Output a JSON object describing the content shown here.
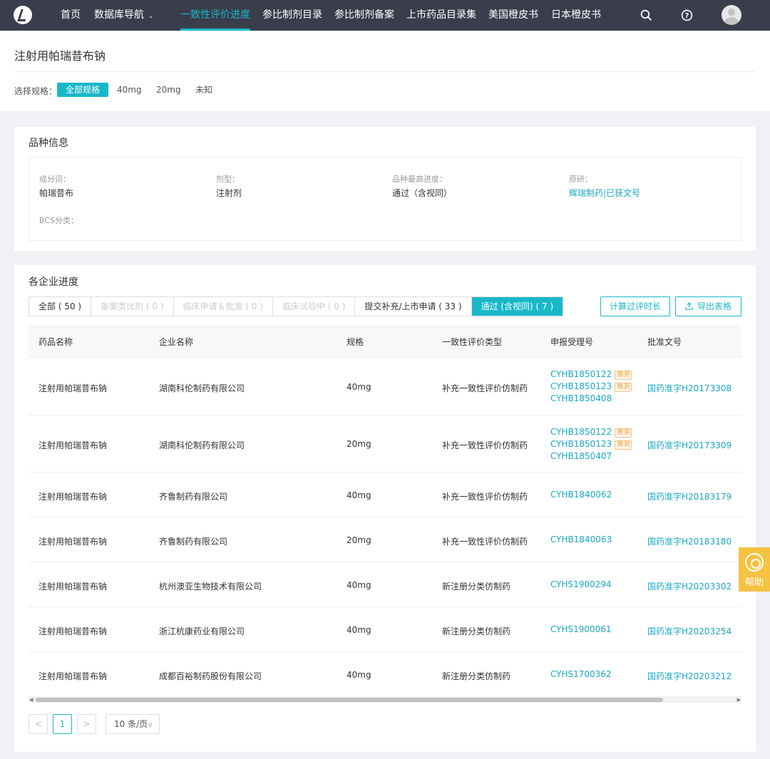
{
  "nav": {
    "items": [
      "首页",
      "数据库导航",
      "一致性评价进度",
      "参比制剂目录",
      "参比制剂备案",
      "上市药品目录集",
      "美国橙皮书",
      "日本橙皮书"
    ],
    "active_index": 2,
    "icons": [
      "search-icon",
      "help-circle-icon",
      "user-avatar"
    ]
  },
  "page": {
    "title": "注射用帕瑞昔布钠",
    "spec_label": "选择规格：",
    "spec_options": [
      "全部规格",
      "40mg",
      "20mg",
      "未知"
    ],
    "spec_selected": 0
  },
  "info": {
    "title": "品种信息",
    "fields": [
      {
        "label": "成分词：",
        "value": "帕瑞昔布"
      },
      {
        "label": "剂型：",
        "value": "注射剂"
      },
      {
        "label": "品种最高进度：",
        "value": "通过（含视同）"
      },
      {
        "label": "原研：",
        "value": "辉瑞制药|已获文号"
      },
      {
        "label": "BCS分类：",
        "value": ""
      }
    ]
  },
  "progress": {
    "title": "各企业进度",
    "tabs": [
      {
        "label": "全部 ( 50 )",
        "state": "normal"
      },
      {
        "label": "备案类比剂 ( 0 )",
        "state": "disabled"
      },
      {
        "label": "临床申请＆批准 ( 0 )",
        "state": "disabled"
      },
      {
        "label": "临床试验中 ( 0 )",
        "state": "disabled"
      },
      {
        "label": "提交补充/上市申请 ( 33 )",
        "state": "normal"
      },
      {
        "label": "通过 (含视同) ( 7 )",
        "state": "active"
      }
    ],
    "calc_button": "计算过评时长",
    "export_button": "导出表格",
    "columns": [
      "药品名称",
      "企业名称",
      "规格",
      "一致性评价类型",
      "申报受理号",
      "批准文号"
    ],
    "rows": [
      {
        "drug": "注射用帕瑞昔布钠",
        "company": "湖南科伦制药有限公司",
        "spec": "40mg",
        "type": "补充一致性评价仿制药",
        "accept": [
          {
            "no": "CYHB1850122",
            "tag": "推测"
          },
          {
            "no": "CYHB1850123",
            "tag": "推测"
          },
          {
            "no": "CYHB1850408",
            "tag": ""
          }
        ],
        "approval": "国药准字H20173308"
      },
      {
        "drug": "注射用帕瑞昔布钠",
        "company": "湖南科伦制药有限公司",
        "spec": "20mg",
        "type": "补充一致性评价仿制药",
        "accept": [
          {
            "no": "CYHB1850122",
            "tag": "推测"
          },
          {
            "no": "CYHB1850123",
            "tag": "推测"
          },
          {
            "no": "CYHB1850407",
            "tag": ""
          }
        ],
        "approval": "国药准字H20173309"
      },
      {
        "drug": "注射用帕瑞昔布钠",
        "company": "齐鲁制药有限公司",
        "spec": "40mg",
        "type": "补充一致性评价仿制药",
        "accept": [
          {
            "no": "CYHB1840062",
            "tag": ""
          }
        ],
        "approval": "国药准字H20183179"
      },
      {
        "drug": "注射用帕瑞昔布钠",
        "company": "齐鲁制药有限公司",
        "spec": "20mg",
        "type": "补充一致性评价仿制药",
        "accept": [
          {
            "no": "CYHB1840063",
            "tag": ""
          }
        ],
        "approval": "国药准字H20183180"
      },
      {
        "drug": "注射用帕瑞昔布钠",
        "company": "杭州澳亚生物技术有限公司",
        "spec": "40mg",
        "type": "新注册分类仿制药",
        "accept": [
          {
            "no": "CYHS1900294",
            "tag": ""
          }
        ],
        "approval": "国药准字H20203302"
      },
      {
        "drug": "注射用帕瑞昔布钠",
        "company": "浙江杭康药业有限公司",
        "spec": "40mg",
        "type": "新注册分类仿制药",
        "accept": [
          {
            "no": "CYHS1900061",
            "tag": ""
          }
        ],
        "approval": "国药准字H20203254"
      },
      {
        "drug": "注射用帕瑞昔布钠",
        "company": "成都百裕制药股份有限公司",
        "spec": "40mg",
        "type": "新注册分类仿制药",
        "accept": [
          {
            "no": "CYHS1700362",
            "tag": ""
          }
        ],
        "approval": "国药准字H20203212"
      }
    ],
    "pager": {
      "prev": "<",
      "current": "1",
      "next": ">",
      "page_size": "10 条/页"
    }
  },
  "help": {
    "label": "帮助"
  },
  "colors": {
    "accent": "#19b8c9",
    "nav_bg": "#3a3d4c",
    "link": "#19a8c4",
    "tag": "#f0a23c",
    "help_bg": "#f5c242"
  }
}
